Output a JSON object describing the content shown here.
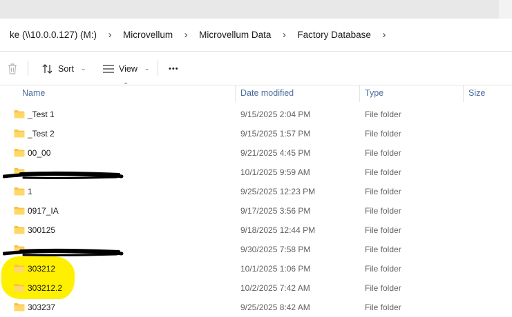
{
  "breadcrumb": {
    "items": [
      "ke (\\\\10.0.0.127) (M:)",
      "Microvellum",
      "Microvellum Data",
      "Factory Database"
    ],
    "separator": "›"
  },
  "toolbar": {
    "sort_label": "Sort",
    "view_label": "View",
    "more_label": "•••"
  },
  "columns": {
    "name": "Name",
    "date_modified": "Date modified",
    "type": "Type",
    "size": "Size"
  },
  "files": [
    {
      "name": "_Test 1",
      "date": "9/15/2025 2:04 PM",
      "type": "File folder"
    },
    {
      "name": "_Test 2",
      "date": "9/15/2025 1:57 PM",
      "type": "File folder"
    },
    {
      "name": "00_00",
      "date": "9/21/2025 4:45 PM",
      "type": "File folder"
    },
    {
      "name": "",
      "date": "10/1/2025 9:59 AM",
      "type": "File folder"
    },
    {
      "name": "1",
      "date": "9/25/2025 12:23 PM",
      "type": "File folder"
    },
    {
      "name": "0917_IA",
      "date": "9/17/2025 3:56 PM",
      "type": "File folder"
    },
    {
      "name": "300125",
      "date": "9/18/2025 12:44 PM",
      "type": "File folder"
    },
    {
      "name": "",
      "date": "9/30/2025 7:58 PM",
      "type": "File folder"
    },
    {
      "name": "303212",
      "date": "10/1/2025 1:06 PM",
      "type": "File folder"
    },
    {
      "name": "303212.2",
      "date": "10/2/2025 7:42 AM",
      "type": "File folder"
    },
    {
      "name": "303237",
      "date": "9/25/2025 8:42 AM",
      "type": "File folder"
    }
  ],
  "colors": {
    "folder": "#f6c342",
    "header_text": "#4a6d9c",
    "highlight": "#ffef00"
  }
}
